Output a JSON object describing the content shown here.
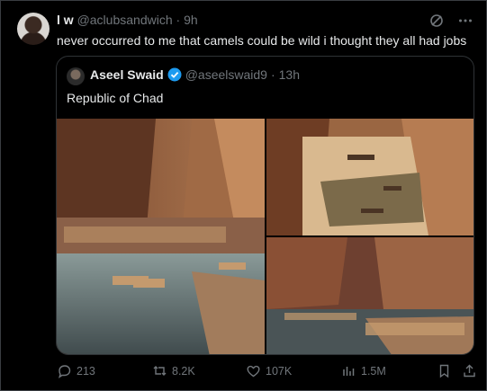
{
  "tweet": {
    "author_name": "l w",
    "author_handle": "@aclubsandwich",
    "time_sep": "·",
    "time": "9h",
    "text": "never occurred to me that camels could be wild i thought they all had jobs"
  },
  "quote": {
    "author_name": "Aseel Swaid",
    "author_handle": "@aseelswaid9",
    "time_sep": "·",
    "time": "13h",
    "text": "Republic of Chad",
    "verified": true
  },
  "actions": {
    "replies": "213",
    "reposts": "8.2K",
    "likes": "107K",
    "views": "1.5M"
  },
  "colors": {
    "background": "#000000",
    "text": "#e7e9ea",
    "muted": "#71767b",
    "verified": "#1d9bf0",
    "border": "#2f3336"
  },
  "icons": [
    "grok-icon",
    "more-icon",
    "verified-badge-icon",
    "reply-icon",
    "repost-icon",
    "like-icon",
    "views-icon",
    "bookmark-icon",
    "share-icon"
  ]
}
